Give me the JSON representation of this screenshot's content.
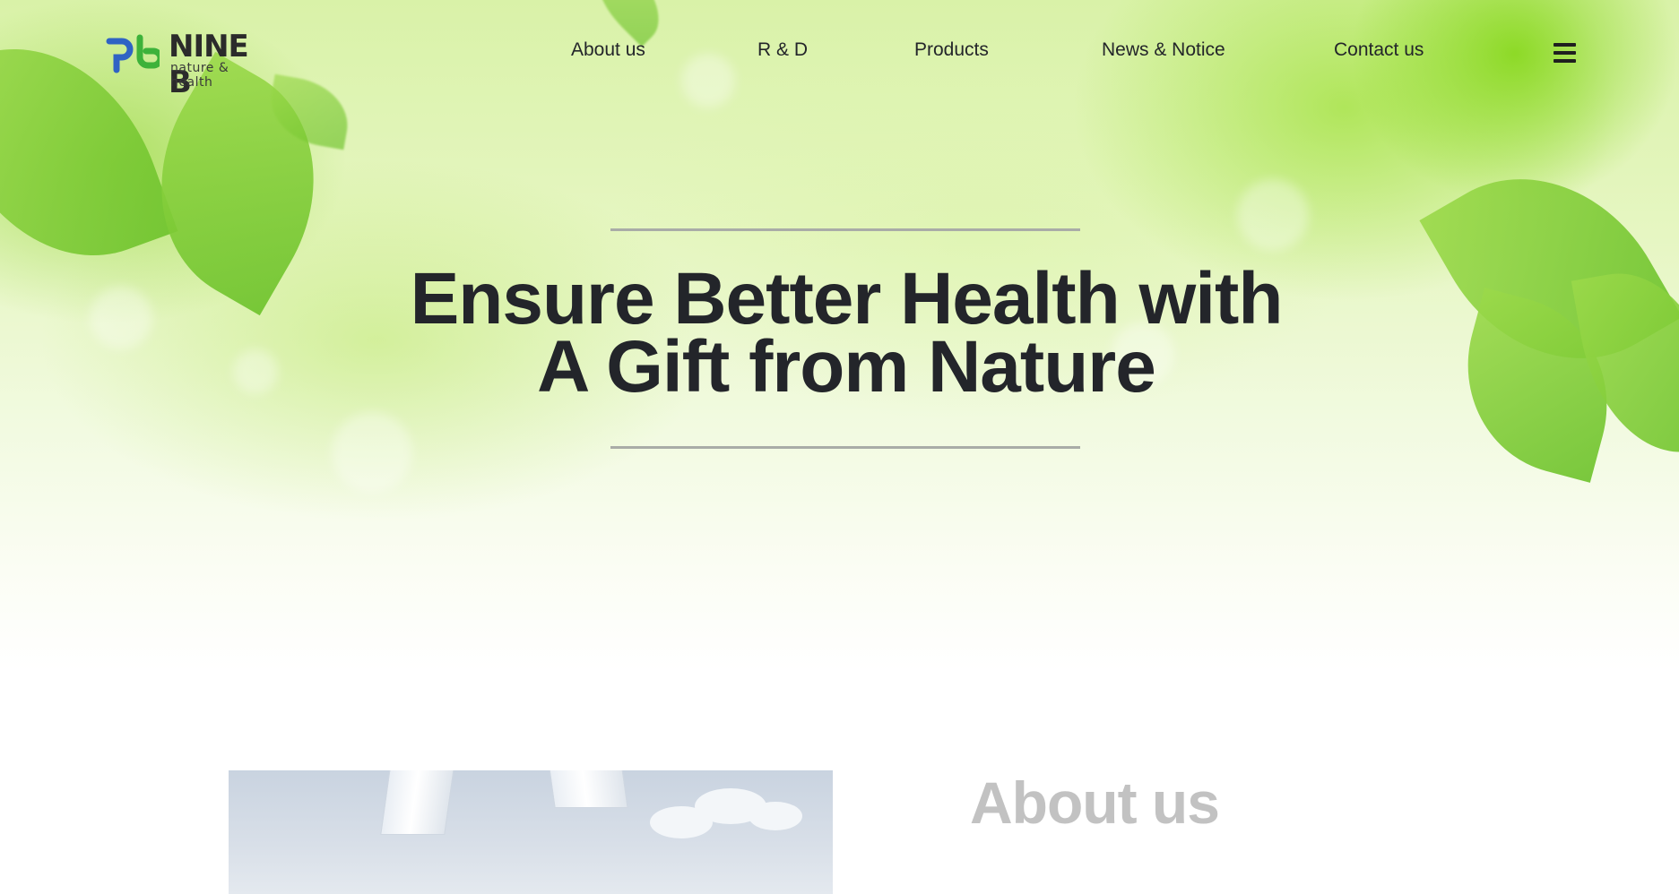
{
  "brand": {
    "name": "NINE B",
    "tagline": "nature & health",
    "colors": {
      "blue": "#2f63c4",
      "green": "#3db23a"
    }
  },
  "nav": {
    "items": [
      {
        "label": "About us"
      },
      {
        "label": "R & D"
      },
      {
        "label": "Products"
      },
      {
        "label": "News & Notice"
      },
      {
        "label": "Contact us"
      }
    ],
    "menu_icon": "hamburger-icon"
  },
  "hero": {
    "headline_line1": "Ensure Better Health with",
    "headline_line2": "A Gift from Nature"
  },
  "about": {
    "title": "About us"
  }
}
